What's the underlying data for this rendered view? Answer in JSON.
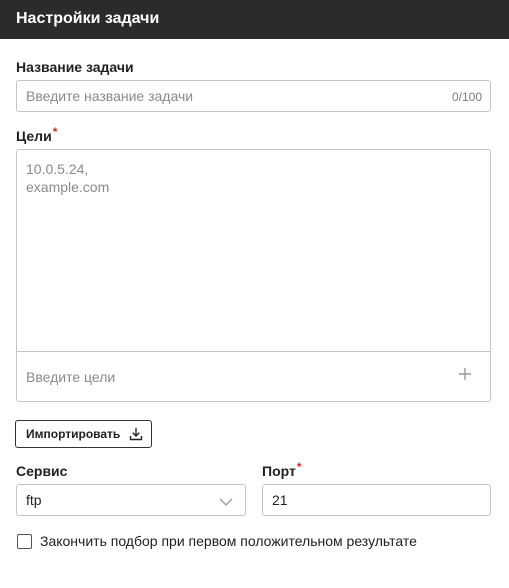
{
  "header": {
    "title": "Настройки задачи"
  },
  "task_name": {
    "label": "Название задачи",
    "placeholder": "Введите название задачи",
    "counter": "0/100"
  },
  "targets": {
    "label": "Цели",
    "required_mark": "*",
    "textarea_placeholder_line1": "10.0.5.24,",
    "textarea_placeholder_line2": "example.com",
    "input_placeholder": "Введите цели",
    "add_icon": "plus-icon"
  },
  "import_button": {
    "label": "Импортировать",
    "icon": "download-icon"
  },
  "service": {
    "label": "Сервис",
    "value": "ftp",
    "icon": "chevron-down-icon"
  },
  "port": {
    "label": "Порт",
    "required_mark": "*",
    "value": "21"
  },
  "stop_on_first": {
    "label": "Закончить подбор при первом положительном результате",
    "checked": false
  },
  "colors": {
    "header_bg": "#2b2b2b",
    "required": "#d32f2f",
    "border": "#c4c4c4"
  }
}
